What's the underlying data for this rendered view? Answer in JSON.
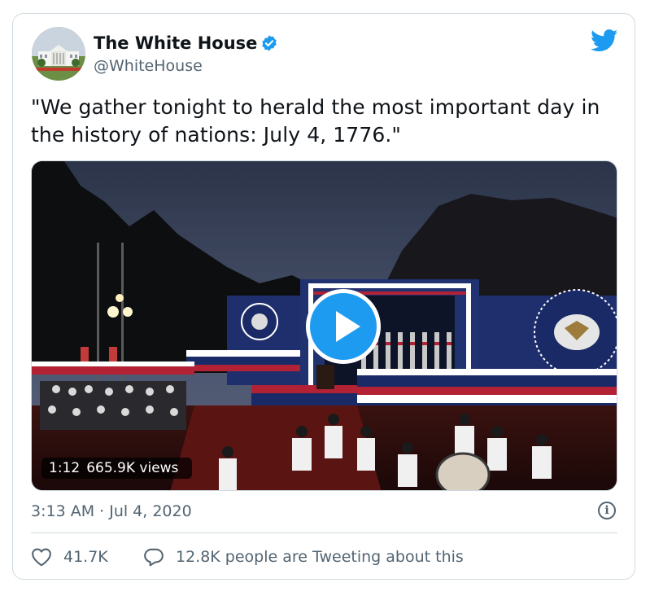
{
  "tweet": {
    "author_name": "The White House",
    "author_handle": "@WhiteHouse",
    "verified": true,
    "text": "\"We gather tonight to herald the most important day in the history of nations: July 4, 1776.\"",
    "media": {
      "type": "video",
      "duration": "1:12",
      "views": "665.9K views"
    },
    "timestamp": "3:13 AM · Jul 4, 2020",
    "likes": "41.7K",
    "conversation": "12.8K people are Tweeting about this"
  },
  "icons": {
    "brand": "twitter-bird-icon",
    "verified": "verified-badge-icon",
    "info": "info-icon",
    "like": "heart-icon",
    "reply": "speech-bubble-icon",
    "play": "play-icon"
  },
  "colors": {
    "accent": "#1d9bf0",
    "text_primary": "#0f1419",
    "text_secondary": "#536471",
    "border": "#cfd9de"
  }
}
